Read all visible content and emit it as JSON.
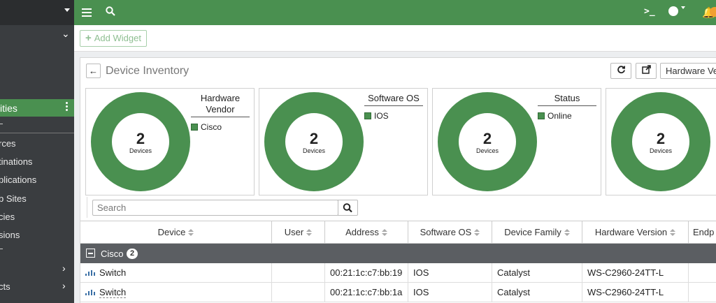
{
  "sidebar": {
    "active_item": "ities",
    "items": [
      "rces",
      "tinations",
      "plications",
      "b Sites",
      "cies",
      "sions"
    ],
    "bottom_items": [
      "",
      "cts"
    ]
  },
  "topbar": {
    "menu_icon": "hamburger-menu-icon",
    "search_icon": "search-icon",
    "terminal_glyph": ">_",
    "help_glyph": "?",
    "bell_icon": "bell-icon",
    "accent_color": "#4a9050"
  },
  "widgetbar": {
    "add_widget_label": "Add Widget"
  },
  "panel": {
    "title": "Device Inventory",
    "hardware_select_value": "Hardware Ve"
  },
  "cards": [
    {
      "legend_title": "Hardware Vendor",
      "legend_items": [
        "Cisco"
      ],
      "count": "2",
      "count_label": "Devices"
    },
    {
      "legend_title": "Software OS",
      "legend_items": [
        "IOS"
      ],
      "count": "2",
      "count_label": "Devices"
    },
    {
      "legend_title": "Status",
      "legend_items": [
        "Online"
      ],
      "count": "2",
      "count_label": "Devices"
    },
    {
      "legend_title": "",
      "legend_items": [],
      "count": "2",
      "count_label": "Devices"
    }
  ],
  "table": {
    "search_placeholder": "Search",
    "columns": [
      "Device",
      "User",
      "Address",
      "Software OS",
      "Device Family",
      "Hardware Version",
      "Endp"
    ],
    "group": {
      "name": "Cisco",
      "count": "2"
    },
    "rows": [
      {
        "device": "Switch",
        "user": "",
        "address": "00:21:1c:c7:bb:19",
        "os": "IOS",
        "family": "Catalyst",
        "hw": "WS-C2960-24TT-L"
      },
      {
        "device": "Switch",
        "user": "",
        "address": "00:21:1c:c7:bb:1a",
        "os": "IOS",
        "family": "Catalyst",
        "hw": "WS-C2960-24TT-L"
      }
    ]
  }
}
